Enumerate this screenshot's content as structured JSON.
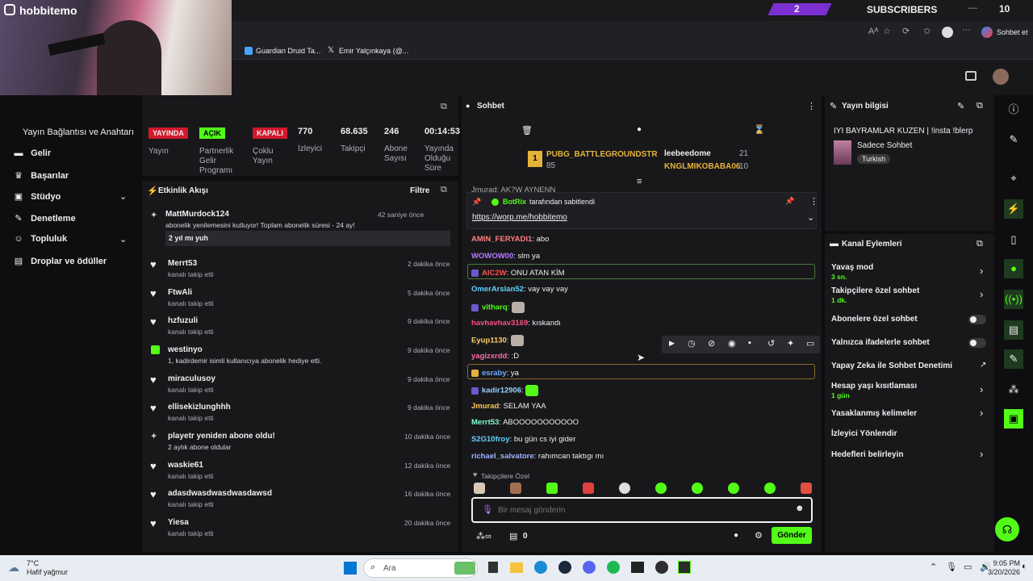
{
  "webcam": {
    "username": "hobbitemo"
  },
  "topbar": {
    "gift_count": "2",
    "subscribers_label": "SUBSCRIBERS",
    "subscribers_count": "10"
  },
  "browser": {
    "chat_button": "Sohbet et"
  },
  "bookmarks": [
    {
      "label": "Guardian Druid Ta..."
    },
    {
      "label": "Emir Yalçınkaya (@..."
    }
  ],
  "sidebar": {
    "header": "Yayın Bağlantısı ve Anahtarı",
    "items": [
      {
        "label": "Gelir",
        "icon": "money-icon"
      },
      {
        "label": "Başarılar",
        "icon": "trophy-icon"
      },
      {
        "label": "Stüdyo",
        "icon": "camera-icon"
      },
      {
        "label": "Denetleme",
        "icon": "wrench-icon"
      },
      {
        "label": "Topluluk",
        "icon": "people-icon"
      },
      {
        "label": "Droplar ve ödüller",
        "icon": "gift-icon"
      }
    ]
  },
  "stats": {
    "stream_status": "YAYINDA",
    "stream_label": "Yayın",
    "partner_status": "AÇIK",
    "partner_label": "Partnerlik Gelir Programı",
    "multi_status": "KAPALI",
    "multi_label": "Çoklu Yayın",
    "viewers": "770",
    "viewers_label": "İzleyici",
    "followers": "68.635",
    "followers_label": "Takipçi",
    "subs": "246",
    "subs_label": "Abone Sayısı",
    "uptime": "00:14:53",
    "uptime_label": "Yayında Olduğu Süre"
  },
  "activity": {
    "title": "Etkinlik Akışı",
    "filter": "Filtre",
    "items": [
      {
        "name": "MattMurdock124",
        "desc": "abonelik yenilemesini kutluyor! Toplam abonelik süresi - 24 ay!",
        "time": "42 saniye önce",
        "msg": "2 yıl mı yuh",
        "icon": "star-icon"
      },
      {
        "name": "Merrt53",
        "desc": "kanalı takip etti",
        "time": "2 dakika önce",
        "icon": "heart-icon"
      },
      {
        "name": "FtwAli",
        "desc": "kanalı takip etti",
        "time": "5 dakika önce",
        "icon": "heart-icon"
      },
      {
        "name": "hzfuzuli",
        "desc": "kanalı takip etti",
        "time": "9 dakika önce",
        "icon": "heart-icon"
      },
      {
        "name": "westinyo",
        "desc": "1, kadirdemir isimli kullanıcıya abonelik hediye etti.",
        "time": "9 dakika önce",
        "icon": "gift-icon"
      },
      {
        "name": "miraculusoy",
        "desc": "kanalı takip etti",
        "time": "9 dakika önce",
        "icon": "heart-icon"
      },
      {
        "name": "ellisekizlunghhh",
        "desc": "kanalı takip etti",
        "time": "9 dakika önce",
        "icon": "heart-icon"
      },
      {
        "name": "playetr yeniden abone oldu!",
        "desc": "2 aylık abone oldular",
        "time": "10 dakika önce",
        "icon": "star-icon"
      },
      {
        "name": "waskie61",
        "desc": "kanalı takip etti",
        "time": "12 dakika önce",
        "icon": "heart-icon"
      },
      {
        "name": "adasdwasdwasdwasdawsd",
        "desc": "kanalı takip etti",
        "time": "16 dakika önce",
        "icon": "heart-icon"
      },
      {
        "name": "Yiesa",
        "desc": "kanalı takip etti",
        "time": "20 dakika önce",
        "icon": "heart-icon"
      }
    ]
  },
  "chat": {
    "title": "Sohbet",
    "leaderboard": {
      "top_name": "PUBG_BATTLEGROUNDSTR",
      "top_count": "85",
      "second_name": "leebeedome",
      "second_count": "21",
      "third_name": "KNGLMIKOBABA06",
      "third_count": "10"
    },
    "partial_line": "Jmurad: AK?W AYNENN",
    "pinned": {
      "by": "BotRix",
      "by_suffix": "tarafından sabitlendi",
      "link": "https://worp.me/hobbitemo"
    },
    "messages": [
      {
        "user": "AMIN_FERYADI1",
        "text": "abo",
        "color": "#ff7f7f"
      },
      {
        "user": "WOWOW00",
        "text": "slm ya",
        "color": "#b57bff"
      },
      {
        "user": "AIC2W",
        "text": "ONU ATAN KİM",
        "color": "#ff4f4f"
      },
      {
        "user": "OmerArslan52",
        "text": "vay vay vay",
        "color": "#5fd3ff"
      },
      {
        "user": "vitharq",
        "text": "",
        "color": "#53fc18"
      },
      {
        "user": "havhavhav3169",
        "text": "kıskandı",
        "color": "#ff4f7f"
      },
      {
        "user": "Eyup1130",
        "text": "",
        "color": "#ffd166"
      },
      {
        "user": "yagizxrdd",
        "text": ":D",
        "color": "#ff6ba8"
      },
      {
        "user": "esraby",
        "text": "ya",
        "color": "#6fa8ff"
      },
      {
        "user": "kadir12906",
        "text": "",
        "color": "#9ad0ff"
      },
      {
        "user": "Jmurad",
        "text": "SELAM YAA",
        "color": "#ffc857"
      },
      {
        "user": "Merrt53",
        "text": "ABOOOOOOOOOOO",
        "color": "#7fffd4"
      },
      {
        "user": "S2G10froy",
        "text": "bu gün cs iyi gider",
        "color": "#5fd3ff"
      },
      {
        "user": "richael_salvatore",
        "text": "rahımcan taktıgı mı",
        "color": "#9fb4ff"
      }
    ],
    "followers_only_label": "Takipçilere Özel",
    "input_placeholder": "Bir mesaj gönderin",
    "points": "0",
    "send_label": "Gönder"
  },
  "stream_info": {
    "title": "Yayın bilgisi",
    "stream_title": "IYI BAYRAMLAR KUZEN | !insta !blerp",
    "category": "Sadece Sohbet",
    "tag": "Turkish"
  },
  "channel_actions": {
    "title": "Kanal Eylemleri",
    "items": [
      {
        "label": "Yavaş mod",
        "value": "3 sn."
      },
      {
        "label": "Takipçilere özel sohbet",
        "value": "1 dk."
      },
      {
        "label": "Abonelere özel sohbet",
        "value": ""
      },
      {
        "label": "Yalnızca ifadelerle sohbet",
        "value": ""
      },
      {
        "label": "Yapay Zeka ile Sohbet Denetimi",
        "value": ""
      },
      {
        "label": "Hesap yaşı kısıtlaması",
        "value": "1 gün"
      },
      {
        "label": "Yasaklanmış kelimeler",
        "value": ""
      },
      {
        "label": "İzleyici Yönlendir",
        "value": ""
      },
      {
        "label": "Hedefleri belirleyin",
        "value": ""
      }
    ]
  },
  "taskbar": {
    "weather_temp": "7°C",
    "weather_desc": "Hafif yağmur",
    "search": "Ara",
    "time": "9:05 PM",
    "date": "3/20/2026"
  }
}
